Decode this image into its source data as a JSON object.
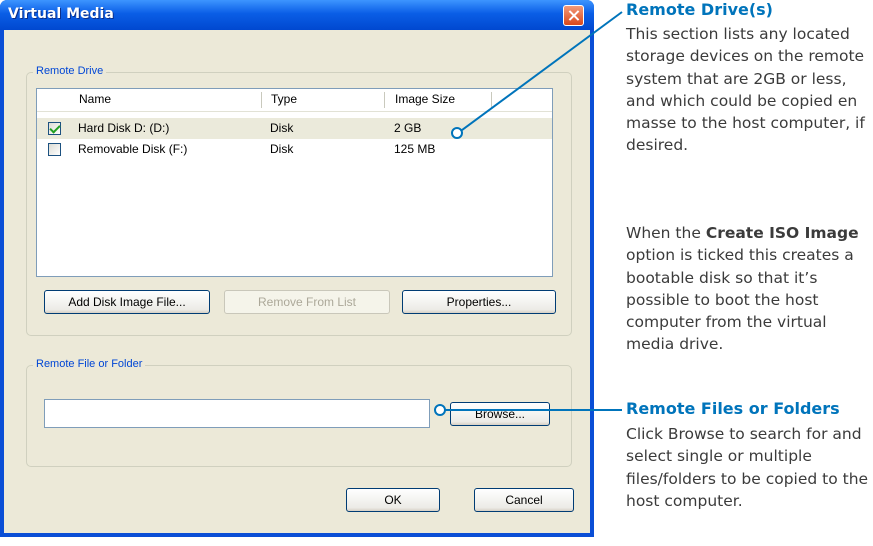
{
  "window": {
    "title": "Virtual Media"
  },
  "remote_drive": {
    "group_label": "Remote Drive",
    "columns": [
      "Name",
      "Type",
      "Image Size"
    ],
    "rows": [
      {
        "name": "Hard Disk D: (D:)",
        "type": "Disk",
        "size": "2 GB",
        "checked": true,
        "selected": true
      },
      {
        "name": "Removable Disk (F:)",
        "type": "Disk",
        "size": "125 MB",
        "checked": false,
        "selected": false
      }
    ],
    "buttons": {
      "add": "Add Disk Image File...",
      "remove": "Remove From List",
      "properties": "Properties..."
    }
  },
  "remote_file": {
    "group_label": "Remote File or Folder",
    "path_value": "",
    "browse": "Browse..."
  },
  "dialog_buttons": {
    "ok": "OK",
    "cancel": "Cancel"
  },
  "annotations": {
    "drives_title": "Remote Drive(s)",
    "drives_body": "This section lists any located storage devices on the remote system that are 2GB or less, and which could be copied en masse to the host computer, if desired.",
    "iso_prefix": "When the ",
    "iso_bold": "Create ISO Image",
    "iso_suffix": " option is ticked this creates a bootable disk so that it’s possible to boot the host computer from the virtual media drive.",
    "files_title": "Remote Files or Folders",
    "files_body": "Click Browse to search for and select single or multiple files/folders to be copied to the host computer."
  },
  "colors": {
    "accent": "#0074bb",
    "titlebar": "#0a5ee6",
    "group_label": "#0046d5"
  }
}
